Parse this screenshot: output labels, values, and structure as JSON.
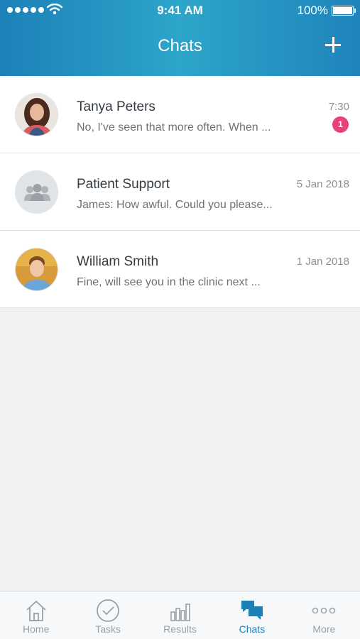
{
  "status_bar": {
    "time": "9:41 AM",
    "battery": "100%"
  },
  "header": {
    "title": "Chats"
  },
  "chats": [
    {
      "name": "Tanya Peters",
      "preview": "No, I've seen that more often. When ...",
      "date": "7:30",
      "unread": "1",
      "avatar": "woman-photo"
    },
    {
      "name": "Patient Support",
      "preview": "James: How awful. Could you please...",
      "date": "5 Jan 2018",
      "avatar": "group-icon"
    },
    {
      "name": "William Smith",
      "preview": "Fine, will see you in the clinic next ...",
      "date": "1 Jan 2018",
      "avatar": "man-photo"
    }
  ],
  "tabs": [
    {
      "label": "Home",
      "icon": "home-icon"
    },
    {
      "label": "Tasks",
      "icon": "check-circle-icon"
    },
    {
      "label": "Results",
      "icon": "bar-chart-icon"
    },
    {
      "label": "Chats",
      "icon": "chat-bubbles-icon",
      "active": true
    },
    {
      "label": "More",
      "icon": "more-dots-icon"
    }
  ],
  "colors": {
    "accent": "#1c81b8",
    "badge": "#e8417d",
    "background": "#eff1f3"
  }
}
